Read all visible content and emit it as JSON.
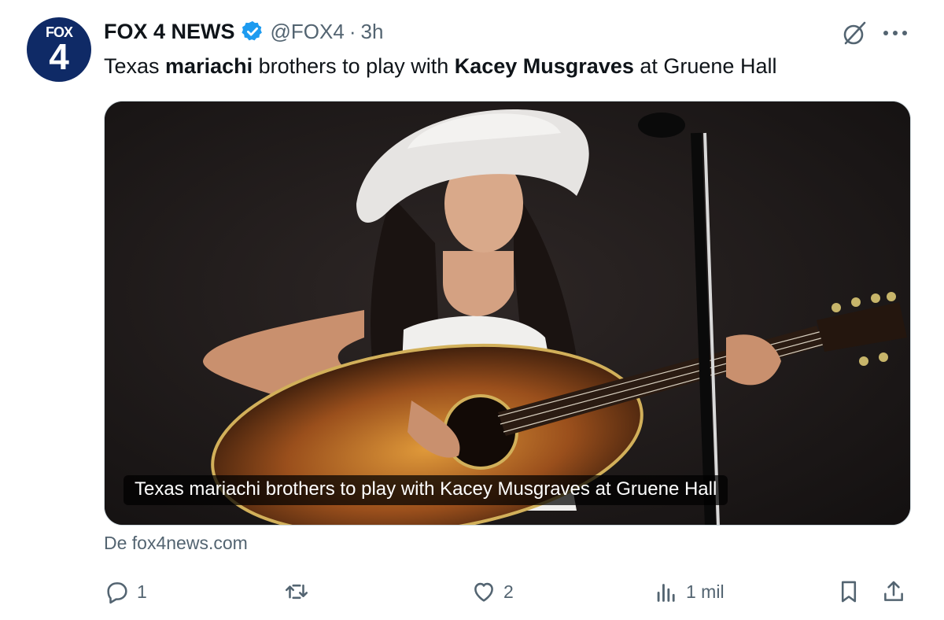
{
  "account": {
    "avatar_line1": "FOX",
    "avatar_line2": "4",
    "display_name": "FOX 4 NEWS",
    "handle": "@FOX4",
    "separator": "·",
    "time": "3h",
    "verified_color": "#1d9bf0"
  },
  "tweet": {
    "text_parts": [
      "Texas ",
      "mariachi",
      " brothers to play with ",
      "Kacey Musgraves",
      " at Gruene Hall"
    ]
  },
  "card": {
    "caption": "Texas mariachi brothers to play with Kacey Musgraves at Gruene Hall",
    "source": "De fox4news.com"
  },
  "actions": {
    "replies": "1",
    "retweets": "",
    "likes": "2",
    "views": "1 mil"
  },
  "icons": [
    "grok-icon",
    "more-icon",
    "reply-icon",
    "retweet-icon",
    "like-icon",
    "views-icon",
    "bookmark-icon",
    "share-icon"
  ]
}
